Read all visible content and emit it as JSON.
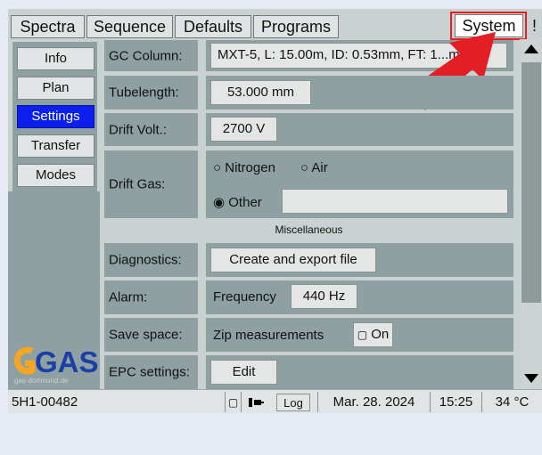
{
  "tabs": [
    {
      "label": "Spectra"
    },
    {
      "label": "Sequence"
    },
    {
      "label": "Defaults"
    },
    {
      "label": "Programs"
    }
  ],
  "system_tab": {
    "label": "System",
    "highlight_color": "#e31e24"
  },
  "exclamation": "!",
  "sidebar": {
    "items": [
      {
        "label": "Info"
      },
      {
        "label": "Plan"
      },
      {
        "label": "Settings",
        "active": true
      },
      {
        "label": "Transfer"
      },
      {
        "label": "Modes"
      }
    ]
  },
  "settings": {
    "gc_column": {
      "label": "GC Column:",
      "value": "MXT-5, L: 15.00m, ID: 0.53mm, FT: 1...m..."
    },
    "tubelength": {
      "label": "Tubelength:",
      "value": "53.000 mm"
    },
    "drift_volt": {
      "label": "Drift Volt.:",
      "value": "2700 V"
    },
    "drift_gas": {
      "label": "Drift Gas:",
      "options": [
        "Nitrogen",
        "Air",
        "Other"
      ],
      "selected": "Other",
      "other_value": ""
    },
    "misc_header": "Miscellaneous",
    "diagnostics": {
      "label": "Diagnostics:",
      "button": "Create and export file"
    },
    "alarm": {
      "label": "Alarm:",
      "freq_label": "Frequency",
      "freq_value": "440 Hz"
    },
    "save_space": {
      "label": "Save space:",
      "zip_label": "Zip measurements",
      "toggle_label": "On"
    },
    "epc": {
      "label": "EPC settings:",
      "button": "Edit"
    }
  },
  "logo": {
    "text": "GAS",
    "sub": "gas-dortmund.de"
  },
  "status": {
    "device_id": "5H1-00482",
    "log": "Log",
    "date": "Mar. 28. 2024",
    "time": "15:25",
    "temp": "34 °C"
  },
  "colors": {
    "accent": "#0a1ff0",
    "arrow": "#e31e24",
    "logo_orange": "#f5a623",
    "logo_blue": "#1a3fa6"
  }
}
